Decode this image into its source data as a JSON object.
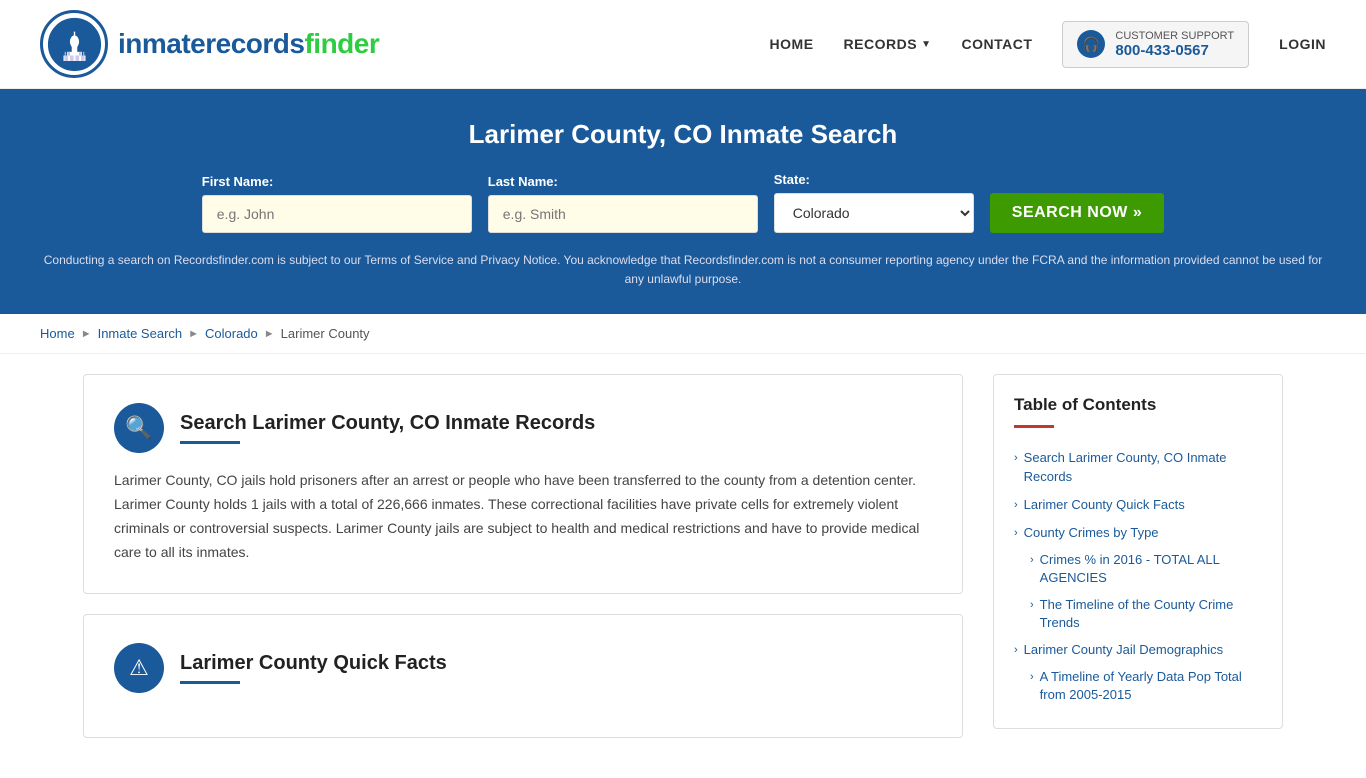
{
  "header": {
    "logo_text_part1": "inmaterecords",
    "logo_text_part2": "finder",
    "nav": {
      "home": "HOME",
      "records": "RECORDS",
      "contact": "CONTACT",
      "login": "LOGIN"
    },
    "support": {
      "label": "CUSTOMER SUPPORT",
      "phone": "800-433-0567"
    }
  },
  "hero": {
    "title": "Larimer County, CO Inmate Search",
    "form": {
      "first_name_label": "First Name:",
      "first_name_placeholder": "e.g. John",
      "last_name_label": "Last Name:",
      "last_name_placeholder": "e.g. Smith",
      "state_label": "State:",
      "state_value": "Colorado",
      "search_button": "SEARCH NOW »"
    },
    "disclaimer": "Conducting a search on Recordsfinder.com is subject to our Terms of Service and Privacy Notice. You acknowledge that Recordsfinder.com is not a consumer reporting agency under the FCRA and the information provided cannot be used for any unlawful purpose."
  },
  "breadcrumb": {
    "items": [
      "Home",
      "Inmate Search",
      "Colorado",
      "Larimer County"
    ]
  },
  "content": {
    "section1": {
      "title": "Search Larimer County, CO Inmate Records",
      "body": "Larimer County, CO jails hold prisoners after an arrest or people who have been transferred to the county from a detention center. Larimer County holds 1 jails with a total of 226,666 inmates. These correctional facilities have private cells for extremely violent criminals or controversial suspects. Larimer County jails are subject to health and medical restrictions and have to provide medical care to all its inmates."
    },
    "section2": {
      "title": "Larimer County Quick Facts"
    }
  },
  "toc": {
    "title": "Table of Contents",
    "items": [
      {
        "label": "Search Larimer County, CO Inmate Records",
        "indent": false
      },
      {
        "label": "Larimer County Quick Facts",
        "indent": false
      },
      {
        "label": "County Crimes by Type",
        "indent": false
      },
      {
        "label": "Crimes % in 2016 - TOTAL ALL AGENCIES",
        "indent": true
      },
      {
        "label": "The Timeline of the County Crime Trends",
        "indent": true
      },
      {
        "label": "Larimer County Jail Demographics",
        "indent": false
      },
      {
        "label": "A Timeline of Yearly Data Pop Total from 2005-2015",
        "indent": true
      }
    ]
  },
  "icons": {
    "search": "🔍",
    "alert": "⚠",
    "headset": "🎧",
    "chevron_right": "›",
    "chevron_down": "▾"
  },
  "colors": {
    "primary": "#1a5a9a",
    "green": "#3d9a00",
    "hero_bg": "#1a5a9a",
    "red_underline": "#c0392b"
  }
}
